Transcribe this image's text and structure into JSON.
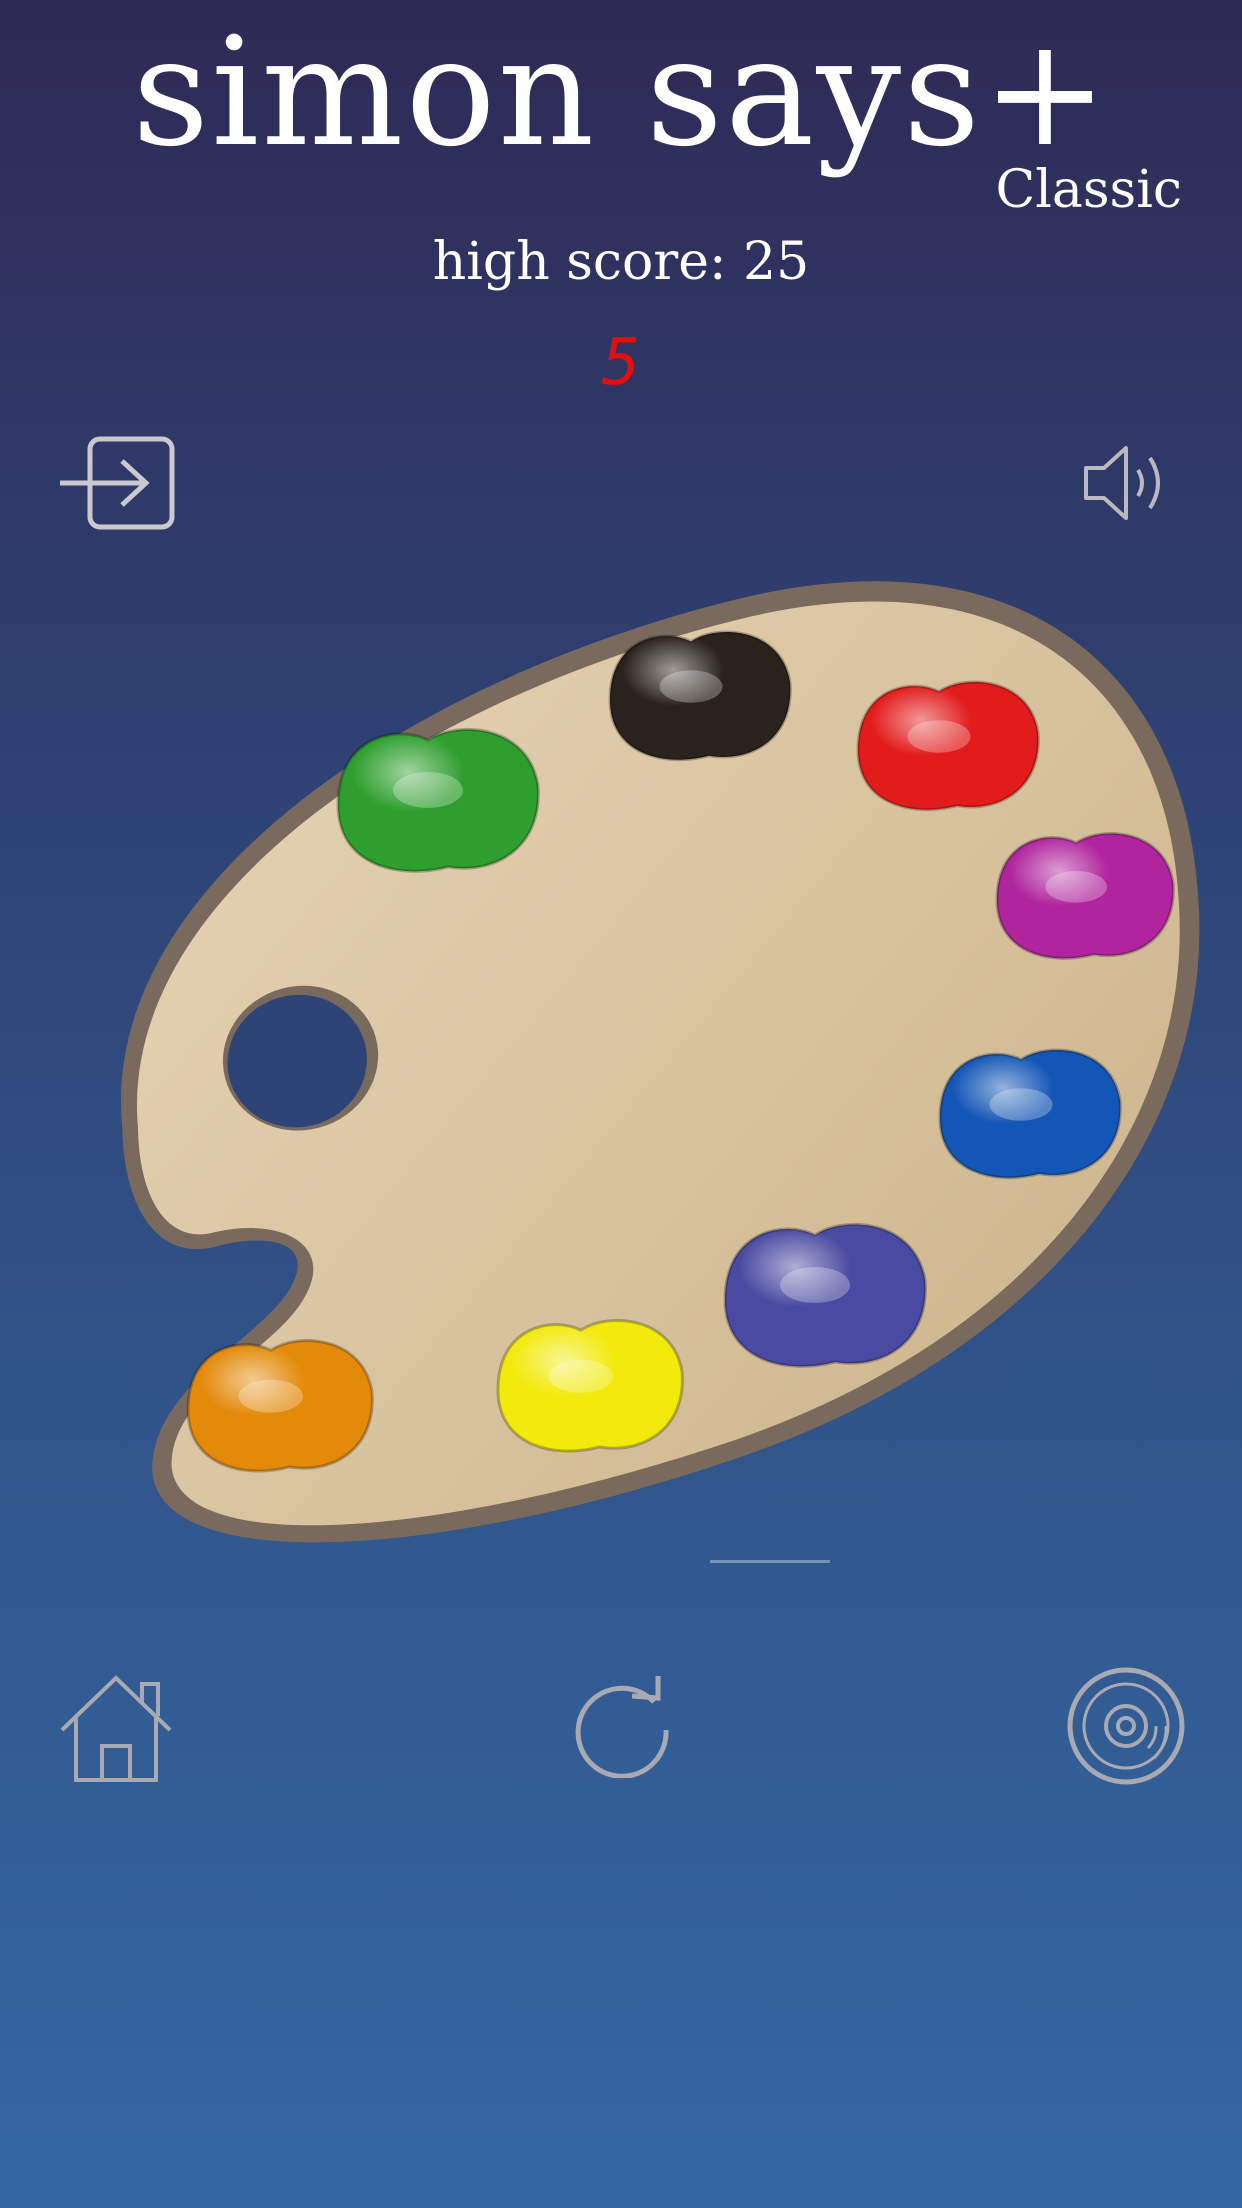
{
  "header": {
    "title": "simon says+",
    "mode": "Classic",
    "high_score_label": "high score: 25",
    "current_score": "5"
  },
  "toolbar_top": {
    "exit_icon": "sign-in-icon",
    "sound_icon": "speaker-icon"
  },
  "palette": {
    "paints": [
      {
        "name": "green",
        "color": "#2e9e2e"
      },
      {
        "name": "black",
        "color": "#2a221c"
      },
      {
        "name": "red",
        "color": "#e21b1b"
      },
      {
        "name": "magenta",
        "color": "#b0259e"
      },
      {
        "name": "blue",
        "color": "#1456b5"
      },
      {
        "name": "indigo",
        "color": "#4a4aa2"
      },
      {
        "name": "yellow",
        "color": "#f2ea0c"
      },
      {
        "name": "orange",
        "color": "#e38a0a"
      }
    ]
  },
  "toolbar_bottom": {
    "home_icon": "home-icon",
    "restart_icon": "restart-icon",
    "music_icon": "disc-icon"
  }
}
